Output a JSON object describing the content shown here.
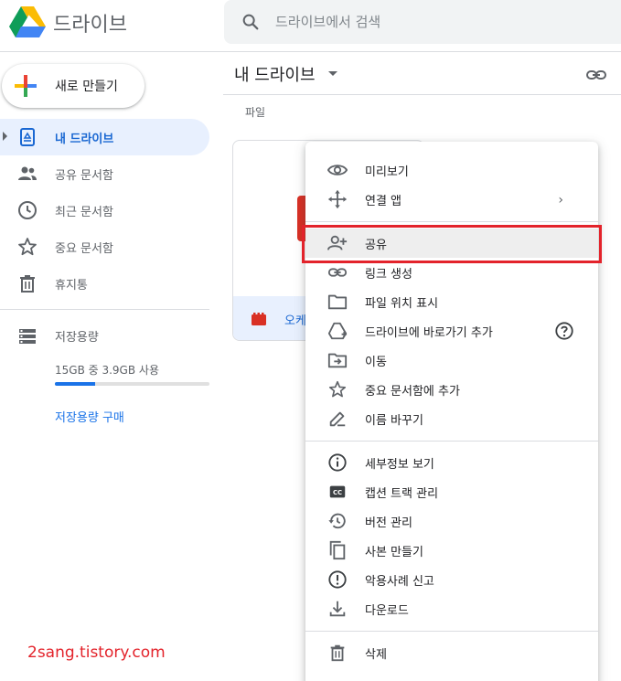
{
  "app": {
    "title": "드라이브",
    "logo_icon": "google-drive-logo"
  },
  "search": {
    "placeholder": "드라이브에서 검색",
    "value": ""
  },
  "sidebar": {
    "new_button_label": "새로 만들기",
    "items": [
      {
        "label": "내 드라이브",
        "icon": "my-drive-icon",
        "active": true
      },
      {
        "label": "공유 문서함",
        "icon": "shared-people-icon",
        "active": false
      },
      {
        "label": "최근 문서함",
        "icon": "clock-icon",
        "active": false
      },
      {
        "label": "중요 문서함",
        "icon": "star-icon",
        "active": false
      },
      {
        "label": "휴지통",
        "icon": "trash-icon",
        "active": false
      }
    ],
    "storage": {
      "label": "저장용량",
      "usage": "15GB 중 3.9GB 사용",
      "used_fraction": 0.26,
      "buy_label": "저장용량 구매"
    }
  },
  "main": {
    "title": "내 드라이브",
    "section_label": "파일",
    "file": {
      "name": "오케",
      "type_icon": "video-icon"
    }
  },
  "context_menu": {
    "items": [
      {
        "label": "미리보기",
        "icon": "eye-icon"
      },
      {
        "label": "연결 앱",
        "icon": "move-arrows-icon",
        "submenu": true
      },
      {
        "label": "공유",
        "icon": "person-add-icon",
        "highlighted": true
      },
      {
        "label": "링크 생성",
        "icon": "link-icon"
      },
      {
        "label": "파일 위치 표시",
        "icon": "folder-icon"
      },
      {
        "label": "드라이브에 바로가기 추가",
        "icon": "drive-shortcut-icon",
        "help": true
      },
      {
        "label": "이동",
        "icon": "folder-move-icon"
      },
      {
        "label": "중요 문서함에 추가",
        "icon": "star-icon"
      },
      {
        "label": "이름 바꾸기",
        "icon": "pencil-icon"
      },
      {
        "label": "세부정보 보기",
        "icon": "info-icon"
      },
      {
        "label": "캡션 트랙 관리",
        "icon": "cc-icon"
      },
      {
        "label": "버전 관리",
        "icon": "history-icon"
      },
      {
        "label": "사본 만들기",
        "icon": "copy-icon"
      },
      {
        "label": "악용사례 신고",
        "icon": "report-icon"
      },
      {
        "label": "다운로드",
        "icon": "download-icon"
      },
      {
        "label": "삭제",
        "icon": "trash-icon"
      }
    ]
  },
  "colors": {
    "accent": "#1a73e8",
    "active_bg": "#e8f0fe",
    "highlight_border": "#e3232b"
  },
  "watermark": "2sang.tistory.com"
}
